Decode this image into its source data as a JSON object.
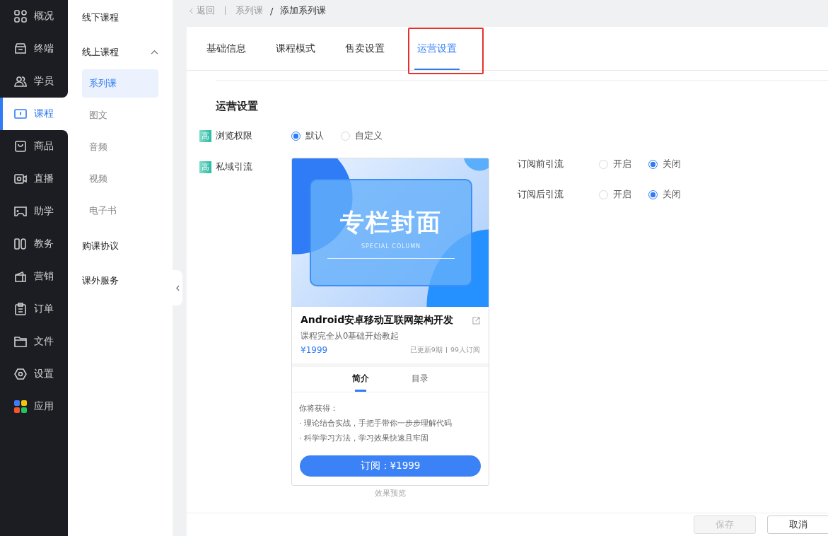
{
  "nav": {
    "items": [
      {
        "label": "概况",
        "selected": false
      },
      {
        "label": "终端",
        "selected": false
      },
      {
        "label": "学员",
        "selected": false
      },
      {
        "label": "课程",
        "selected": true
      },
      {
        "label": "商品",
        "selected": false
      },
      {
        "label": "直播",
        "selected": false
      },
      {
        "label": "助学",
        "selected": false
      },
      {
        "label": "教务",
        "selected": false
      },
      {
        "label": "营销",
        "selected": false
      },
      {
        "label": "订单",
        "selected": false
      },
      {
        "label": "文件",
        "selected": false
      },
      {
        "label": "设置",
        "selected": false
      },
      {
        "label": "应用",
        "selected": false
      }
    ]
  },
  "subnav": {
    "items": [
      {
        "label": "线下课程"
      },
      {
        "label": "线上课程",
        "expanded": true,
        "children": [
          {
            "label": "系列课",
            "selected": true
          },
          {
            "label": "图文",
            "selected": false
          },
          {
            "label": "音频",
            "selected": false
          },
          {
            "label": "视频",
            "selected": false
          },
          {
            "label": "电子书",
            "selected": false
          }
        ]
      },
      {
        "label": "购课协议"
      },
      {
        "label": "课外服务"
      }
    ]
  },
  "breadcrumb": {
    "back": "返回",
    "path": [
      "系列课",
      "添加系列课"
    ],
    "separator": "/"
  },
  "tabs": [
    {
      "label": "基础信息",
      "selected": false,
      "highlighted": false
    },
    {
      "label": "课程模式",
      "selected": false,
      "highlighted": false
    },
    {
      "label": "售卖设置",
      "selected": false,
      "highlighted": false
    },
    {
      "label": "运营设置",
      "selected": true,
      "highlighted": true
    }
  ],
  "section_title": "运营设置",
  "browse_permission": {
    "badge": "高",
    "label": "浏览权限",
    "options": [
      {
        "label": "默认",
        "selected": true
      },
      {
        "label": "自定义",
        "selected": false
      }
    ]
  },
  "private_traffic": {
    "badge": "高",
    "label": "私域引流",
    "preview": {
      "cover_title": "专栏封面",
      "cover_subtitle": "SPECIAL COLUMN",
      "title": "Android安卓移动互联网架构开发",
      "subtitle": "课程完全从0基础开始教起",
      "price": "¥1999",
      "updates": "已更新9期",
      "subscribers": "99人订阅",
      "tabs": [
        {
          "label": "简介",
          "selected": true
        },
        {
          "label": "目录",
          "selected": false
        }
      ],
      "intro_heading": "你将获得：",
      "bullets": [
        "· 理论结合实战，手把手带你一步步理解代码",
        "· 科学学习方法，学习效果快速且牢固"
      ],
      "subscribe_button": "订阅：¥1999"
    },
    "caption": "效果预览",
    "settings": [
      {
        "label": "订阅前引流",
        "options": [
          {
            "label": "开启",
            "selected": false
          },
          {
            "label": "关闭",
            "selected": true
          }
        ]
      },
      {
        "label": "订阅后引流",
        "options": [
          {
            "label": "开启",
            "selected": false
          },
          {
            "label": "关闭",
            "selected": true
          }
        ]
      }
    ]
  },
  "footer": {
    "buttons": [
      {
        "label": "保存",
        "disabled": true
      },
      {
        "label": "取消",
        "disabled": false
      }
    ]
  }
}
